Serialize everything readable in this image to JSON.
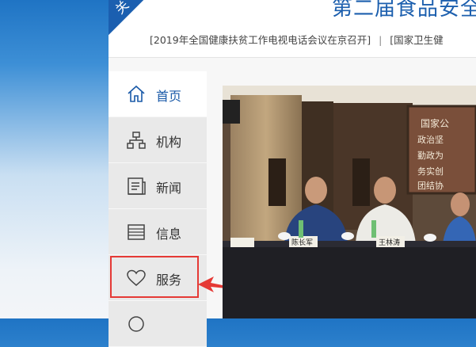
{
  "header": {
    "ribbon_text": "关",
    "site_title": "第二届食品安全",
    "ticker": [
      "[2019年全国健康扶贫工作电视电话会议在京召开]",
      "[国家卫生健"
    ],
    "ticker_separator": "|"
  },
  "sidebar": {
    "items": [
      {
        "label": "首页",
        "icon": "home-icon",
        "active": true
      },
      {
        "label": "机构",
        "icon": "org-chart-icon",
        "active": false
      },
      {
        "label": "新闻",
        "icon": "news-icon",
        "active": false
      },
      {
        "label": "信息",
        "icon": "info-icon",
        "active": false
      },
      {
        "label": "服务",
        "icon": "heart-icon",
        "active": false
      }
    ]
  },
  "photo": {
    "wall_sign_lines": [
      "国家公",
      "政治坚",
      "勤政为",
      "务实创",
      "团结协"
    ],
    "nameplates": [
      "陈长军",
      "王林涛"
    ]
  },
  "colors": {
    "brand_blue": "#1c5fae",
    "highlight_red": "#e53935"
  }
}
